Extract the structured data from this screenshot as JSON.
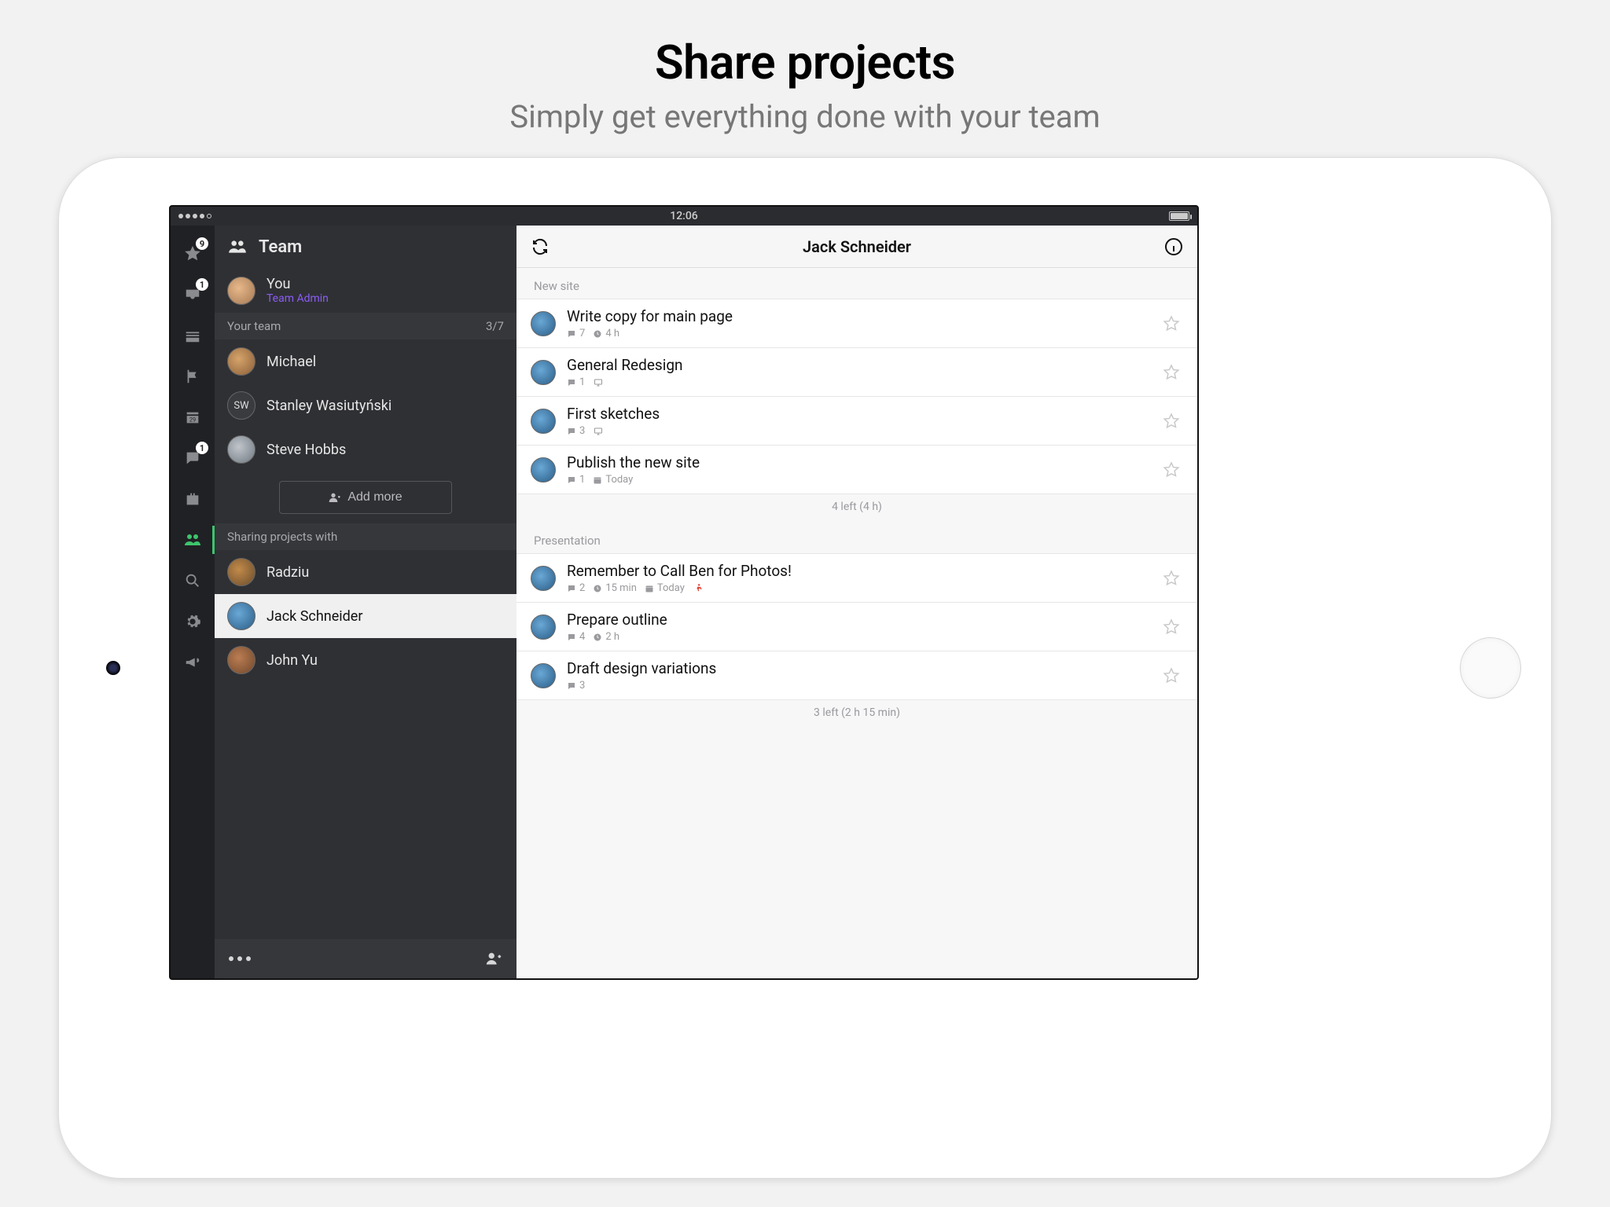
{
  "hero": {
    "title": "Share projects",
    "subtitle": "Simply get everything done with your team"
  },
  "statusbar": {
    "time": "12:06"
  },
  "rail": {
    "badges": {
      "star": "9",
      "inbox": "1",
      "chat": "1"
    }
  },
  "sidebar": {
    "header": "Team",
    "you": {
      "name": "You",
      "role": "Team Admin"
    },
    "team_section": {
      "label": "Your team",
      "count": "3/7"
    },
    "team": [
      {
        "name": "Michael"
      },
      {
        "initials": "SW",
        "name": "Stanley Wasiutyński"
      },
      {
        "name": "Steve Hobbs"
      }
    ],
    "add_more": "Add more",
    "sharing_label": "Sharing projects with",
    "sharing": [
      {
        "name": "Radziu"
      },
      {
        "name": "Jack Schneider",
        "selected": true
      },
      {
        "name": "John Yu"
      }
    ]
  },
  "main": {
    "title": "Jack Schneider",
    "groups": [
      {
        "label": "New site",
        "tasks": [
          {
            "title": "Write copy for main page",
            "comments": "7",
            "time": "4 h"
          },
          {
            "title": "General Redesign",
            "comments": "1",
            "screen": true
          },
          {
            "title": "First sketches",
            "comments": "3",
            "screen": true
          },
          {
            "title": "Publish the new site",
            "comments": "1",
            "date": "Today"
          }
        ],
        "summary": "4 left (4 h)"
      },
      {
        "label": "Presentation",
        "tasks": [
          {
            "title": "Remember to Call Ben for Photos!",
            "comments": "2",
            "time": "15 min",
            "date": "Today",
            "running": true
          },
          {
            "title": "Prepare outline",
            "comments": "4",
            "time": "2 h"
          },
          {
            "title": "Draft design variations",
            "comments": "3"
          }
        ],
        "summary": "3 left (2 h 15 min)"
      }
    ]
  }
}
